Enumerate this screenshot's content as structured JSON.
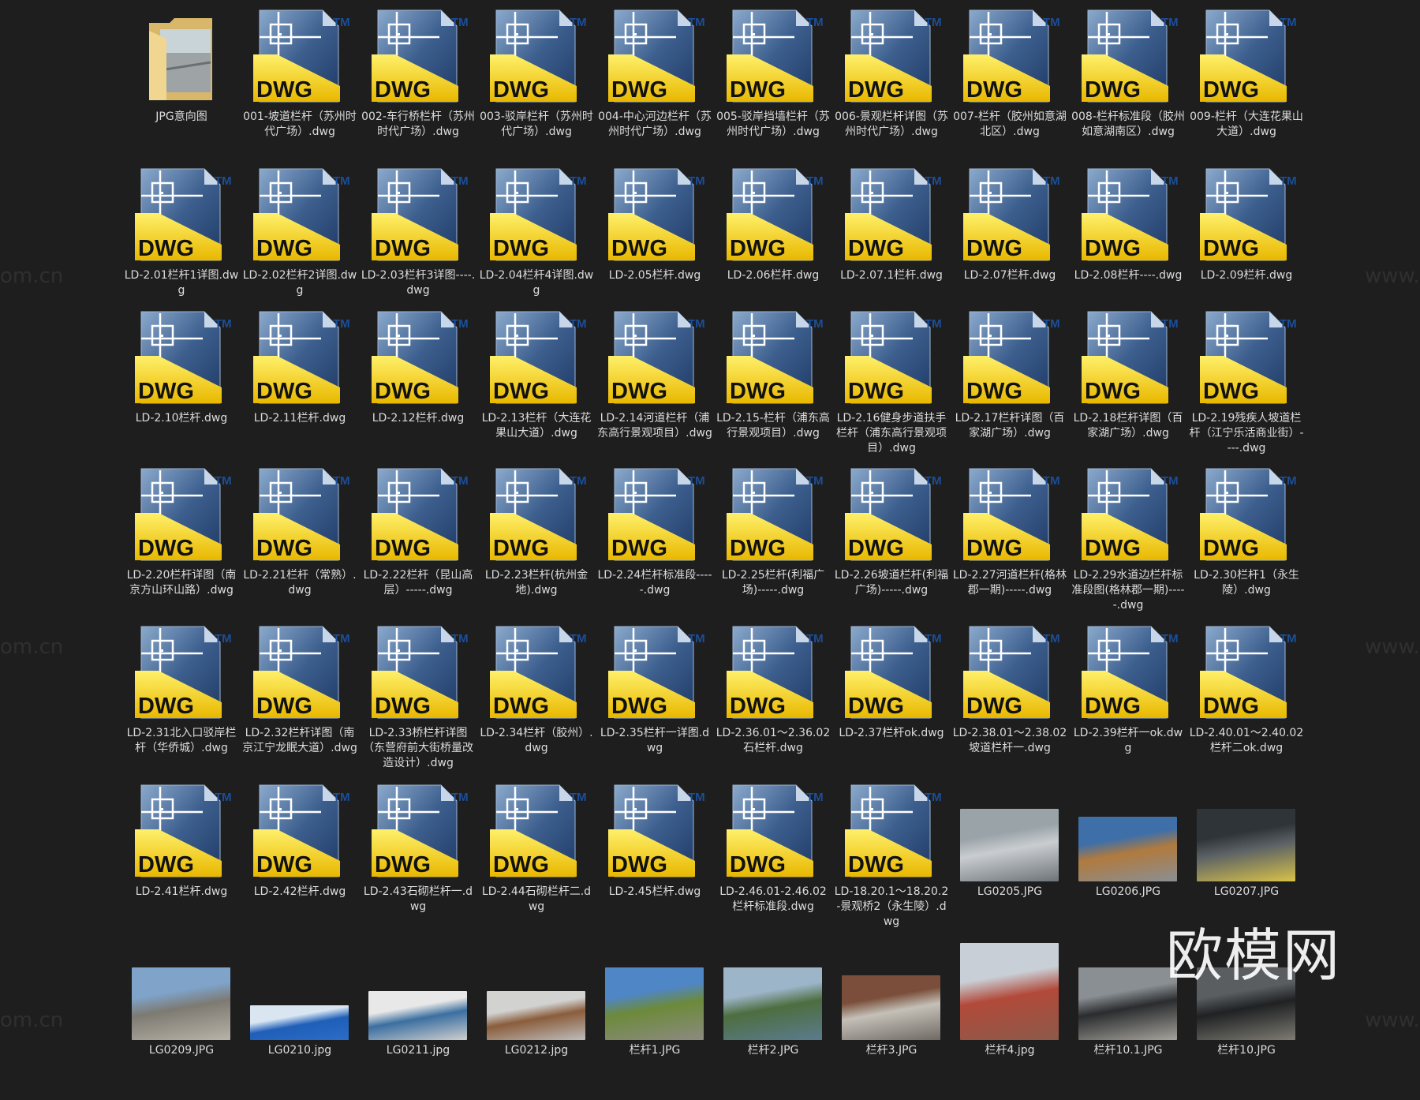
{
  "watermark": "欧模网",
  "watermark_small": [
    "om.cn",
    "om.cn",
    "om.cn",
    "www.om.cn",
    "www.om.cn",
    "www.om.cn"
  ],
  "dwg_icon": {
    "badge": "DWG",
    "tm": "TM"
  },
  "items": [
    {
      "type": "folder",
      "label": "JPG意向图"
    },
    {
      "type": "dwg",
      "label": "001-坡道栏杆（苏州时代广场）.dwg"
    },
    {
      "type": "dwg",
      "label": "002-车行桥栏杆（苏州时代广场）.dwg"
    },
    {
      "type": "dwg",
      "label": "003-驳岸栏杆（苏州时代广场）.dwg"
    },
    {
      "type": "dwg",
      "label": "004-中心河边栏杆（苏州时代广场）.dwg"
    },
    {
      "type": "dwg",
      "label": "005-驳岸挡墙栏杆（苏州时代广场）.dwg"
    },
    {
      "type": "dwg",
      "label": "006-景观栏杆详图（苏州时代广场）.dwg"
    },
    {
      "type": "dwg",
      "label": "007-栏杆（胶州如意湖北区）.dwg"
    },
    {
      "type": "dwg",
      "label": "008-栏杆标准段（胶州如意湖南区）.dwg"
    },
    {
      "type": "dwg",
      "label": "009-栏杆（大连花果山大道）.dwg"
    },
    {
      "type": "dwg",
      "label": "LD-2.01栏杆1详图.dwg"
    },
    {
      "type": "dwg",
      "label": "LD-2.02栏杆2详图.dwg"
    },
    {
      "type": "dwg",
      "label": "LD-2.03栏杆3详图----.dwg"
    },
    {
      "type": "dwg",
      "label": "LD-2.04栏杆4详图.dwg"
    },
    {
      "type": "dwg",
      "label": "LD-2.05栏杆.dwg"
    },
    {
      "type": "dwg",
      "label": "LD-2.06栏杆.dwg"
    },
    {
      "type": "dwg",
      "label": "LD-2.07.1栏杆.dwg"
    },
    {
      "type": "dwg",
      "label": "LD-2.07栏杆.dwg"
    },
    {
      "type": "dwg",
      "label": "LD-2.08栏杆----.dwg"
    },
    {
      "type": "dwg",
      "label": "LD-2.09栏杆.dwg"
    },
    {
      "type": "dwg",
      "label": "LD-2.10栏杆.dwg"
    },
    {
      "type": "dwg",
      "label": "LD-2.11栏杆.dwg"
    },
    {
      "type": "dwg",
      "label": "LD-2.12栏杆.dwg"
    },
    {
      "type": "dwg",
      "label": "LD-2.13栏杆（大连花果山大道）.dwg"
    },
    {
      "type": "dwg",
      "label": "LD-2.14河道栏杆（浦东高行景观项目）.dwg"
    },
    {
      "type": "dwg",
      "label": "LD-2.15-栏杆（浦东高行景观项目）.dwg"
    },
    {
      "type": "dwg",
      "label": "LD-2.16健身步道扶手栏杆（浦东高行景观项目）.dwg"
    },
    {
      "type": "dwg",
      "label": "LD-2.17栏杆详图（百家湖广场）.dwg"
    },
    {
      "type": "dwg",
      "label": "LD-2.18栏杆详图（百家湖广场）.dwg"
    },
    {
      "type": "dwg",
      "label": "LD-2.19残疾人坡道栏杆（江宁乐活商业街）----.dwg"
    },
    {
      "type": "dwg",
      "label": "LD-2.20栏杆详图（南京方山环山路）.dwg"
    },
    {
      "type": "dwg",
      "label": "LD-2.21栏杆（常熟）.dwg"
    },
    {
      "type": "dwg",
      "label": "LD-2.22栏杆（昆山高层）-----.dwg"
    },
    {
      "type": "dwg",
      "label": "LD-2.23栏杆(杭州金地).dwg"
    },
    {
      "type": "dwg",
      "label": "LD-2.24栏杆标准段-----.dwg"
    },
    {
      "type": "dwg",
      "label": "LD-2.25栏杆(利福广场)-----.dwg"
    },
    {
      "type": "dwg",
      "label": "LD-2.26坡道栏杆(利福广场)-----.dwg"
    },
    {
      "type": "dwg",
      "label": "LD-2.27河道栏杆(格林郡一期)-----.dwg"
    },
    {
      "type": "dwg",
      "label": "LD-2.29水道边栏杆标准段图(格林郡一期)-----.dwg"
    },
    {
      "type": "dwg",
      "label": "LD-2.30栏杆1（永生陵）.dwg"
    },
    {
      "type": "dwg",
      "label": "LD-2.31北入口驳岸栏杆（华侨城）.dwg"
    },
    {
      "type": "dwg",
      "label": "LD-2.32栏杆详图（南京江宁龙眠大道）.dwg"
    },
    {
      "type": "dwg",
      "label": "LD-2.33桥栏杆详图（东营府前大街桥量改造设计）.dwg"
    },
    {
      "type": "dwg",
      "label": "LD-2.34栏杆（胶州）.dwg"
    },
    {
      "type": "dwg",
      "label": "LD-2.35栏杆一详图.dwg"
    },
    {
      "type": "dwg",
      "label": "LD-2.36.01～2.36.02石栏杆.dwg"
    },
    {
      "type": "dwg",
      "label": "LD-2.37栏杆ok.dwg"
    },
    {
      "type": "dwg",
      "label": "LD-2.38.01～2.38.02坡道栏杆一.dwg"
    },
    {
      "type": "dwg",
      "label": "LD-2.39栏杆一ok.dwg"
    },
    {
      "type": "dwg",
      "label": "LD-2.40.01～2.40.02栏杆二ok.dwg"
    },
    {
      "type": "dwg",
      "label": "LD-2.41栏杆.dwg"
    },
    {
      "type": "dwg",
      "label": "LD-2.42栏杆.dwg"
    },
    {
      "type": "dwg",
      "label": "LD-2.43石砌栏杆一.dwg"
    },
    {
      "type": "dwg",
      "label": "LD-2.44石砌栏杆二.dwg"
    },
    {
      "type": "dwg",
      "label": "LD-2.45栏杆.dwg"
    },
    {
      "type": "dwg",
      "label": "LD-2.46.01-2.46.02栏杆标准段.dwg"
    },
    {
      "type": "dwg",
      "label": "LD-18.20.1～18.20.2-景观桥2（永生陵）.dwg"
    },
    {
      "type": "img",
      "label": "LG0205.JPG",
      "colors": [
        "#9aa3a8",
        "#c9cdd0",
        "#6d7479"
      ],
      "h": 92
    },
    {
      "type": "img",
      "label": "LG0206.JPG",
      "colors": [
        "#3e6fa8",
        "#b07a3e",
        "#8a8f93"
      ],
      "h": 82
    },
    {
      "type": "img",
      "label": "LG0207.JPG",
      "colors": [
        "#2f3438",
        "#5b6166",
        "#d8c24a"
      ],
      "h": 92
    },
    {
      "type": "img",
      "label": "LG0209.JPG",
      "colors": [
        "#7fa3c9",
        "#7d7a72",
        "#b8b3a8"
      ],
      "h": 92
    },
    {
      "type": "img",
      "label": "LG0210.jpg",
      "colors": [
        "#d9e6f2",
        "#1f5fb8",
        "#2d6cc7"
      ],
      "h": 44
    },
    {
      "type": "img",
      "label": "LG0211.jpg",
      "colors": [
        "#e8e8e8",
        "#3b6fa0",
        "#cfcfcf"
      ],
      "h": 62
    },
    {
      "type": "img",
      "label": "LG0212.jpg",
      "colors": [
        "#d2d2d0",
        "#8a5d3c",
        "#bdbdbb"
      ],
      "h": 62
    },
    {
      "type": "img",
      "label": "栏杆1.JPG",
      "colors": [
        "#4f86c6",
        "#6c8a3a",
        "#8c8a80"
      ],
      "h": 92
    },
    {
      "type": "img",
      "label": "栏杆2.JPG",
      "colors": [
        "#9db5c9",
        "#4d6e3f",
        "#5b7b8e"
      ],
      "h": 92
    },
    {
      "type": "img",
      "label": "栏杆3.JPG",
      "colors": [
        "#7a4e3a",
        "#c4c0b8",
        "#6f6a63"
      ],
      "h": 82
    },
    {
      "type": "img",
      "label": "栏杆4.jpg",
      "colors": [
        "#c9cfd6",
        "#b24a3a",
        "#8c5a4a"
      ],
      "h": 123
    },
    {
      "type": "img",
      "label": "栏杆10.1.JPG",
      "colors": [
        "#8a8f93",
        "#2a2c2e",
        "#a5a39c"
      ],
      "h": 92
    },
    {
      "type": "img",
      "label": "栏杆10.JPG",
      "colors": [
        "#5a5e60",
        "#1f2123",
        "#7d7b72"
      ],
      "h": 92
    }
  ]
}
